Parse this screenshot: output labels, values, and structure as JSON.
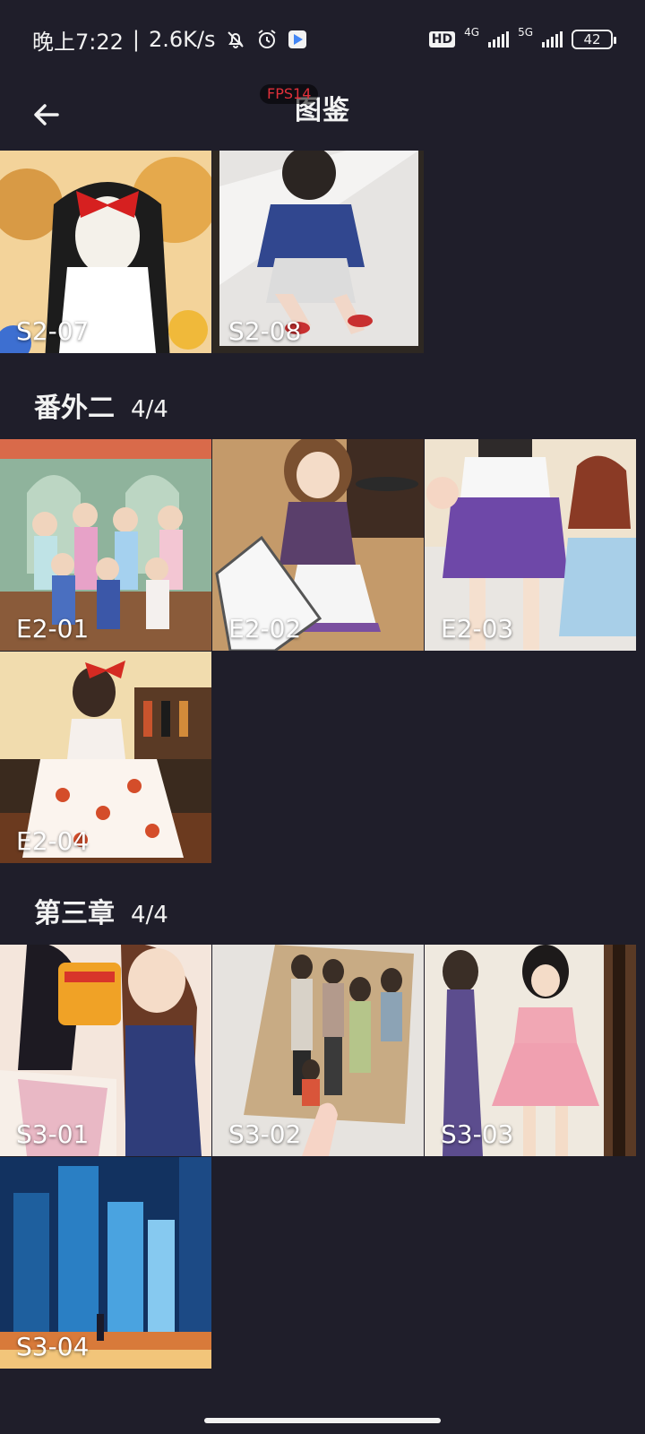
{
  "status_bar": {
    "time": "晚上7:22",
    "speed": "2.6K/s",
    "hd": "HD",
    "net1": "4G",
    "net2": "5G",
    "battery": "42"
  },
  "app_bar": {
    "title": "图鉴",
    "fps": "FPS14"
  },
  "gallery": {
    "s2_tiles": [
      {
        "label": "S2-07"
      },
      {
        "label": "S2-08"
      }
    ],
    "sections": [
      {
        "title": "番外二",
        "count": "4/4"
      },
      {
        "title": "第三章",
        "count": "4/4"
      }
    ],
    "e2_tiles": [
      {
        "label": "E2-01"
      },
      {
        "label": "E2-02"
      },
      {
        "label": "E2-03"
      },
      {
        "label": "E2-04"
      }
    ],
    "s3_tiles": [
      {
        "label": "S3-01"
      },
      {
        "label": "S3-02"
      },
      {
        "label": "S3-03"
      },
      {
        "label": "S3-04"
      }
    ]
  },
  "colors": {
    "background": "#1f1e2a",
    "text": "#f2f2f2",
    "fps": "#e0303a"
  }
}
